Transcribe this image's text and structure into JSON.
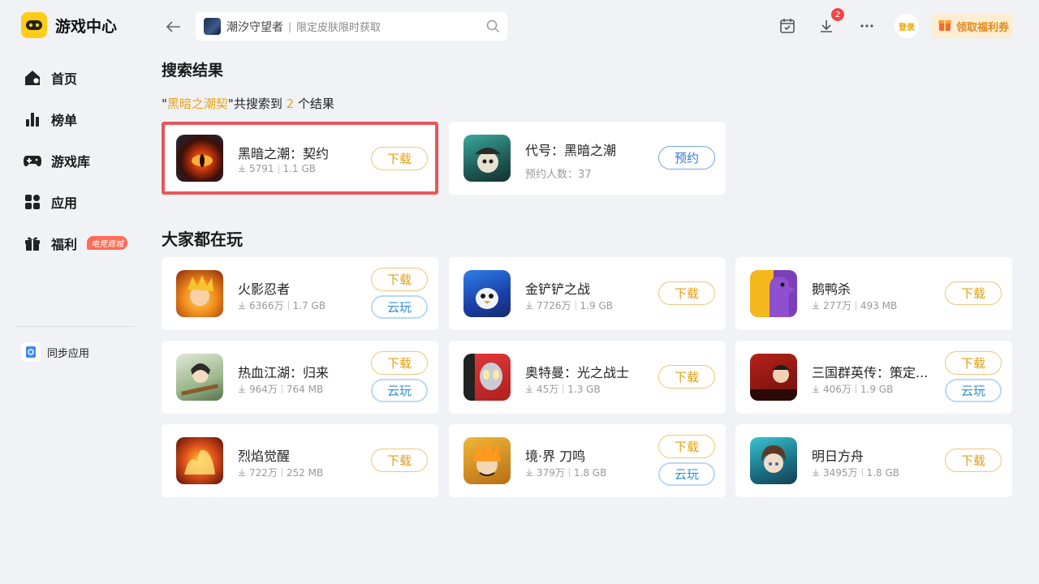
{
  "app": {
    "title": "游戏中心"
  },
  "sidebar": {
    "items": [
      {
        "label": "首页",
        "icon": "home-icon"
      },
      {
        "label": "榜单",
        "icon": "ranking-icon"
      },
      {
        "label": "游戏库",
        "icon": "gamepad-icon"
      },
      {
        "label": "应用",
        "icon": "apps-icon"
      },
      {
        "label": "福利",
        "icon": "gift-icon",
        "badge": "电竞商城"
      }
    ],
    "sync_label": "同步应用"
  },
  "topbar": {
    "search_game": "潮汐守望者",
    "search_hint": "限定皮肤限时获取",
    "download_count": "2",
    "login_label": "登录",
    "coupon_label": "领取福利券"
  },
  "search_results": {
    "title": "搜索结果",
    "quote_open": "\"",
    "keyword": "黑暗之潮契",
    "mid_text": "\"共搜索到 ",
    "count": "2",
    "suffix": " 个结果",
    "items": [
      {
        "name": "黑暗之潮：契约",
        "downloads": "5791",
        "size": "1.1 GB",
        "button": "下载"
      },
      {
        "name": "代号：黑暗之潮",
        "reserve_text": "预约人数：37",
        "button": "预约"
      }
    ]
  },
  "popular": {
    "title": "大家都在玩",
    "items": [
      {
        "name": "火影忍者",
        "downloads": "6366万",
        "size": "1.7 GB",
        "button": "下载",
        "cloud": "云玩"
      },
      {
        "name": "金铲铲之战",
        "downloads": "7726万",
        "size": "1.9 GB",
        "button": "下载"
      },
      {
        "name": "鹅鸭杀",
        "downloads": "277万",
        "size": "493 MB",
        "button": "下载"
      },
      {
        "name": "热血江湖：归来",
        "downloads": "964万",
        "size": "764 MB",
        "button": "下载",
        "cloud": "云玩"
      },
      {
        "name": "奥特曼：光之战士",
        "downloads": "45万",
        "size": "1.3 GB",
        "button": "下载"
      },
      {
        "name": "三国群英传：策定...",
        "downloads": "406万",
        "size": "1.9 GB",
        "button": "下载",
        "cloud": "云玩"
      },
      {
        "name": "烈焰觉醒",
        "downloads": "722万",
        "size": "252 MB",
        "button": "下载"
      },
      {
        "name": "境·界 刀鸣",
        "downloads": "379万",
        "size": "1.8 GB",
        "button": "下载",
        "cloud": "云玩"
      },
      {
        "name": "明日方舟",
        "downloads": "3495万",
        "size": "1.8 GB",
        "button": "下载"
      }
    ]
  },
  "colors": {
    "accent": "#e9a21b",
    "selected_border": "#e9565b",
    "cloud": "#2e90d6",
    "reserve": "#3377d9"
  }
}
